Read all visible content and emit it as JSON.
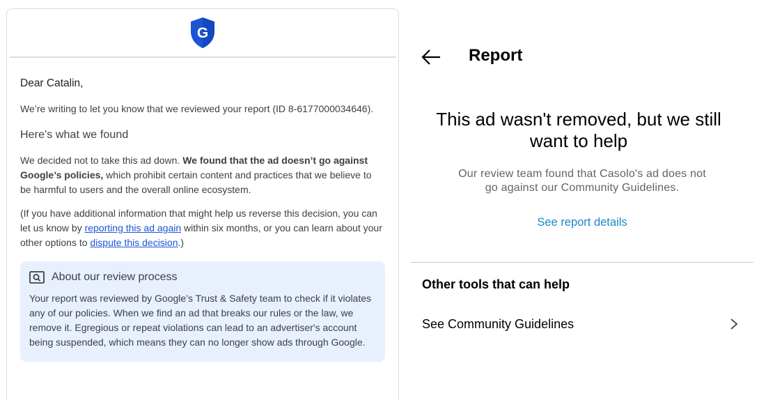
{
  "email": {
    "logo_letter": "G",
    "greeting": "Dear Catalin,",
    "intro": "We’re writing to let you know that we reviewed your report (ID 8-6177000034646).",
    "found_heading": "Here's what we found",
    "decision_lead": "We decided not to take this ad down. ",
    "decision_bold": "We found that the ad doesn’t go against Google’s policies,",
    "decision_tail": " which prohibit certain content and practices that we believe to be harmful to users and the overall online ecosystem.",
    "appeal_part1": "(If you have additional information that might help us reverse this decision, you can let us know by ",
    "appeal_link1": "reporting this ad again",
    "appeal_part2": " within six months, or you can learn about your other options to ",
    "appeal_link2": "dispute this decision",
    "appeal_part3": ".)",
    "review_box": {
      "title": "About our review process",
      "text": "Your report was reviewed by Google’s Trust & Safety team to check if it violates any of our policies. When we find an ad that breaks our rules or the law, we remove it. Egregious or repeat violations can lead to an advertiser's account being suspended, which means they can no longer show ads through Google."
    },
    "colors": {
      "shield": "#1a55d6",
      "link": "#1a55d6",
      "review_bg": "#e8f0fe"
    }
  },
  "report": {
    "title": "Report",
    "result_heading": "This ad wasn't removed, but we still want to help",
    "result_sub": "Our review team found that Casolo's ad does not go against our Community Guidelines.",
    "details_link": "See report details",
    "tools_heading": "Other tools that can help",
    "guidelines_label": "See Community Guidelines",
    "icons": {
      "back": "arrow-left-icon",
      "chevron": "chevron-right-icon"
    },
    "colors": {
      "link": "#1a86c8"
    }
  }
}
